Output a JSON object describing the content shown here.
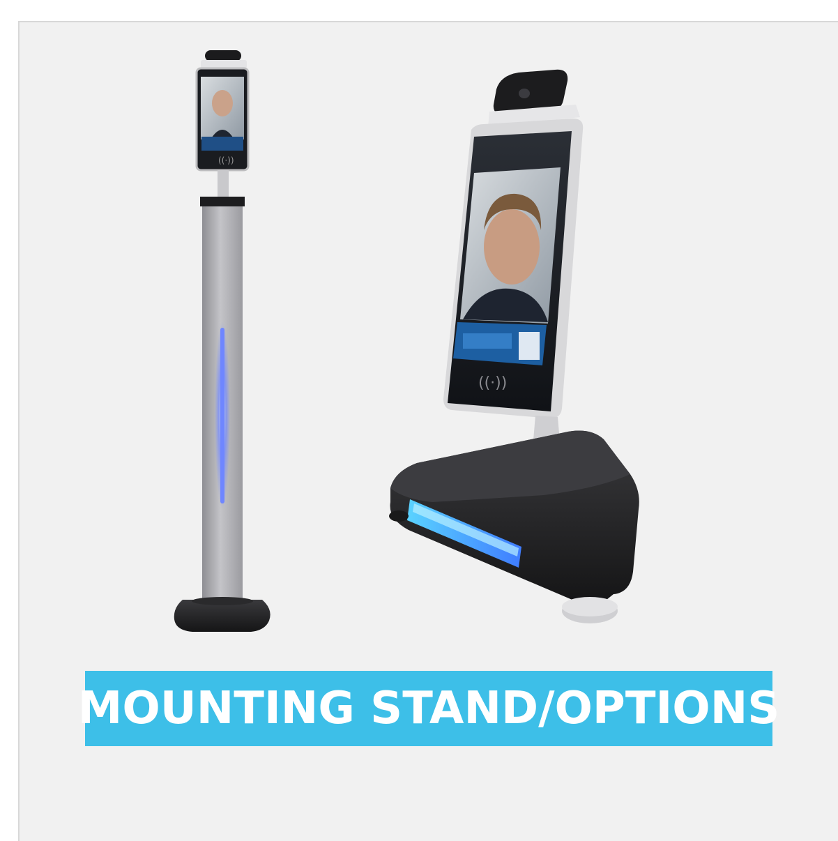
{
  "banner": {
    "label": "MOUNTING STAND/OPTIONS",
    "background_color": "#3dbfe8",
    "text_color": "#ffffff"
  },
  "products": [
    {
      "name": "floor-stand-kiosk",
      "icon": "face-recognition-terminal-on-pole"
    },
    {
      "name": "desktop-stand-kiosk",
      "icon": "face-recognition-terminal-on-triangular-base"
    }
  ],
  "colors": {
    "card_background": "#f1f1f1",
    "light_bar": "#6f86ff",
    "base": "#222222",
    "pole": "#a9a9ad"
  }
}
